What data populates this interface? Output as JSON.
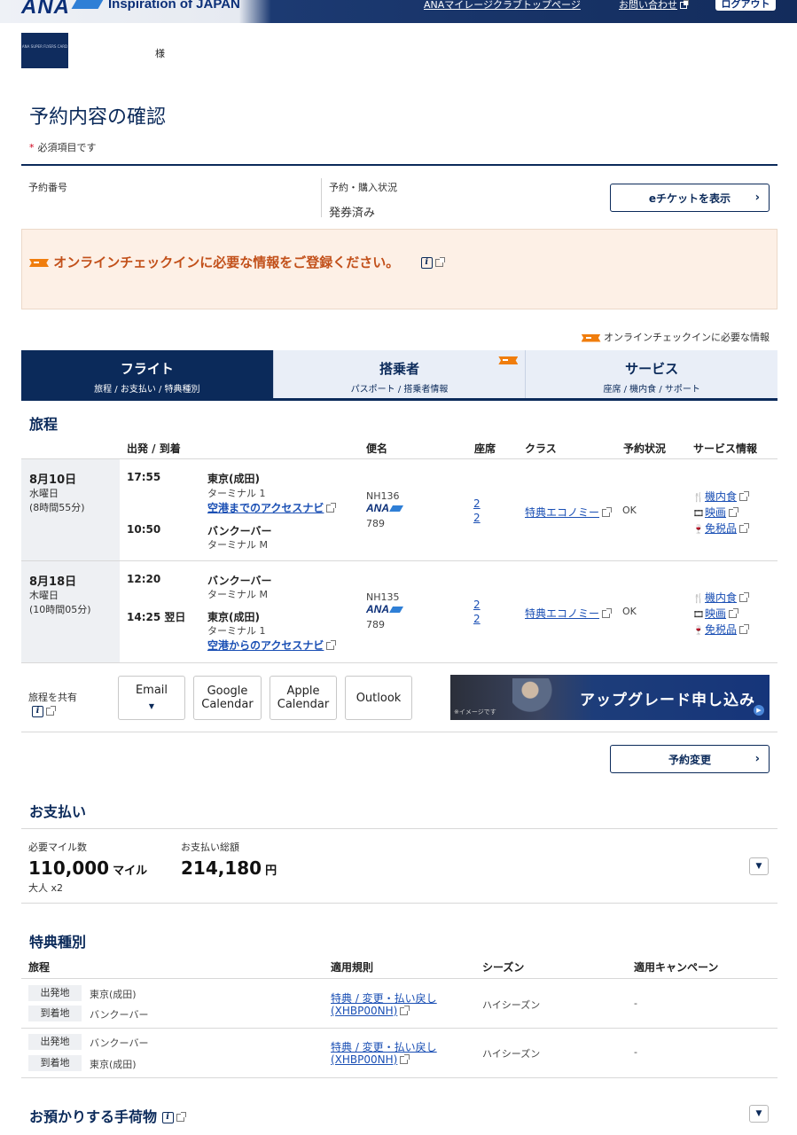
{
  "header": {
    "logo": "ANA",
    "tagline": "Inspiration of JAPAN",
    "links": [
      "ANAマイレージクラブトップページ",
      "お問い合わせ"
    ],
    "logout": "ログアウト"
  },
  "member": {
    "card_text": "ANA SUPER FLYERS CARD",
    "suffix": "様"
  },
  "page": {
    "title": "予約内容の確認",
    "required_note": "必須項目です"
  },
  "booking": {
    "number_label": "予約番号",
    "number_value": "",
    "status_label": "予約・購入状況",
    "status_value": "発券済み",
    "eticket_button": "eチケットを表示"
  },
  "checkin_banner": {
    "text": "オンラインチェックインに必要な情報をご登録ください。"
  },
  "checkin_legend": "オンラインチェックインに必要な情報",
  "tabs": [
    {
      "title": "フライト",
      "sub": "旅程 / お支払い / 特典種別"
    },
    {
      "title": "搭乗者",
      "sub": "パスポート / 搭乗者情報"
    },
    {
      "title": "サービス",
      "sub": "座席 / 機内食 / サポート"
    }
  ],
  "itinerary": {
    "title": "旅程",
    "columns": [
      "出発 / 到着",
      "便名",
      "座席",
      "クラス",
      "予約状況",
      "サービス情報"
    ],
    "legs": [
      {
        "date": "8月10日",
        "weekday": "水曜日",
        "duration": "(8時間55分)",
        "dep_time": "17:55",
        "dep_city": "東京(成田)",
        "dep_terminal": "ターミナル 1",
        "dep_link": "空港までのアクセスナビ",
        "arr_time": "10:50",
        "arr_city": "バンクーバー",
        "arr_terminal": "ターミナル M",
        "flight": "NH136",
        "carrier": "ANA",
        "aircraft": "789",
        "seat1": "2",
        "seat2": "2",
        "class": "特典エコノミー",
        "status": "OK",
        "services": [
          "機内食",
          "映画",
          "免税品"
        ]
      },
      {
        "date": "8月18日",
        "weekday": "木曜日",
        "duration": "(10時間05分)",
        "dep_time": "12:20",
        "dep_city": "バンクーバー",
        "dep_terminal": "ターミナル M",
        "arr_time": "14:25 翌日",
        "arr_city": "東京(成田)",
        "arr_terminal": "ターミナル 1",
        "arr_link": "空港からのアクセスナビ",
        "flight": "NH135",
        "carrier": "ANA",
        "aircraft": "789",
        "seat1": "2",
        "seat2": "2",
        "class": "特典エコノミー",
        "status": "OK",
        "services": [
          "機内食",
          "映画",
          "免税品"
        ]
      }
    ]
  },
  "share": {
    "label": "旅程を共有",
    "email": "Email",
    "google": [
      "Google",
      "Calendar"
    ],
    "apple": [
      "Apple",
      "Calendar"
    ],
    "outlook": "Outlook"
  },
  "upgrade_banner": {
    "text": "アップグレード申し込み",
    "note": "※イメージです"
  },
  "change_button": "予約変更",
  "payment": {
    "title": "お支払い",
    "miles_label": "必要マイル数",
    "miles_value": "110,000",
    "miles_unit": "マイル",
    "pax": "大人 x2",
    "total_label": "お支払い総額",
    "total_value": "214,180",
    "total_unit": "円"
  },
  "award": {
    "title": "特典種別",
    "columns": [
      "旅程",
      "適用規則",
      "シーズン",
      "適用キャンペーン"
    ],
    "dep_label": "出発地",
    "arr_label": "到着地",
    "rows": [
      {
        "dep": "東京(成田)",
        "arr": "バンクーバー",
        "rule1": "特典 / 変更・払い戻し",
        "rule2": "(XHBP00NH)",
        "season": "ハイシーズン",
        "campaign": "-"
      },
      {
        "dep": "バンクーバー",
        "arr": "東京(成田)",
        "rule1": "特典 / 変更・払い戻し",
        "rule2": "(XHBP00NH)",
        "season": "ハイシーズン",
        "campaign": "-"
      }
    ]
  },
  "baggage": {
    "title": "お預かりする手荷物"
  },
  "colors": {
    "navy": "#0b2a5a",
    "orange": "#f07d0d",
    "link": "#1a4fb4",
    "banner_bg": "#fdf0e6"
  }
}
